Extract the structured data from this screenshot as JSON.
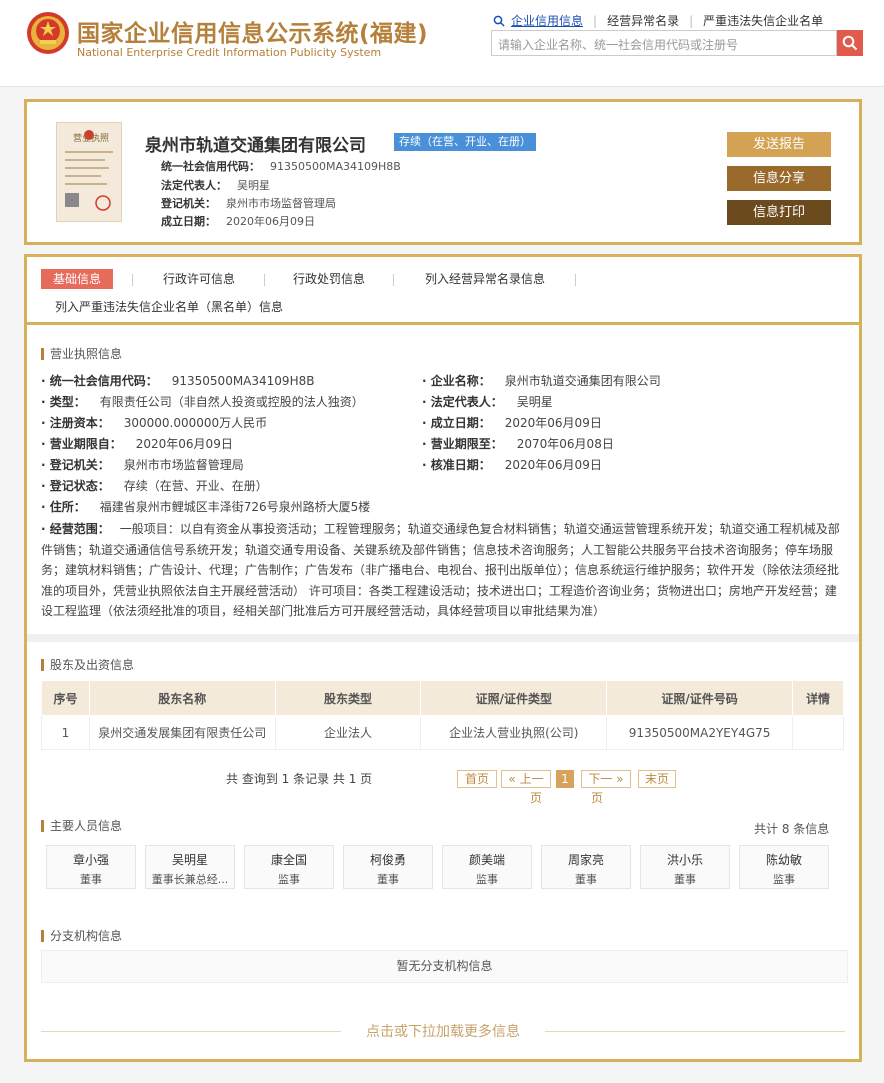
{
  "header": {
    "title": "国家企业信用信息公示系统(福建)",
    "subtitle": "National Enterprise Credit Information Publicity System",
    "links": [
      "企业信用信息",
      "经营异常名录",
      "严重违法失信企业名单"
    ],
    "search_placeholder": "请输入企业名称、统一社会信用代码或注册号"
  },
  "company": {
    "name": "泉州市轨道交通集团有限公司",
    "status": "存续（在营、开业、在册）",
    "credit_code_label": "统一社会信用代码：",
    "credit_code": "91350500MA34109H8B",
    "rep_label": "法定代表人：",
    "rep": "吴明星",
    "authority_label": "登记机关：",
    "authority": "泉州市市场监督管理局",
    "date_label": "成立日期：",
    "date": "2020年06月09日",
    "license_label": "营业执照",
    "buttons": [
      "发送报告",
      "信息分享",
      "信息打印"
    ]
  },
  "tabs": [
    "基础信息",
    "行政许可信息",
    "行政处罚信息",
    "列入经营异常名录信息",
    "列入严重违法失信企业名单（黑名单）信息"
  ],
  "license_section": {
    "title": "营业执照信息",
    "left": [
      {
        "k": "· 统一社会信用代码：",
        "v": "91350500MA34109H8B"
      },
      {
        "k": "· 类型：",
        "v": "有限责任公司（非自然人投资或控股的法人独资）"
      },
      {
        "k": "· 注册资本：",
        "v": "300000.000000万人民币"
      },
      {
        "k": "· 营业期限自：",
        "v": "2020年06月09日"
      },
      {
        "k": "· 登记机关：",
        "v": "泉州市市场监督管理局"
      },
      {
        "k": "· 登记状态：",
        "v": "存续（在营、开业、在册）"
      },
      {
        "k": "· 住所：",
        "v": "福建省泉州市鲤城区丰泽街726号泉州路桥大厦5楼"
      }
    ],
    "right": [
      {
        "k": "· 企业名称：",
        "v": "泉州市轨道交通集团有限公司"
      },
      {
        "k": "· 法定代表人：",
        "v": "吴明星"
      },
      {
        "k": "· 成立日期：",
        "v": "2020年06月09日"
      },
      {
        "k": "· 营业期限至：",
        "v": "2070年06月08日"
      },
      {
        "k": "· 核准日期：",
        "v": "2020年06月09日"
      }
    ],
    "scope_label": "· 经营范围：",
    "scope": "一般项目：以自有资金从事投资活动；工程管理服务；轨道交通绿色复合材料销售；轨道交通运营管理系统开发；轨道交通工程机械及部件销售；轨道交通通信信号系统开发；轨道交通专用设备、关键系统及部件销售；信息技术咨询服务；人工智能公共服务平台技术咨询服务；停车场服务；建筑材料销售；广告设计、代理；广告制作；广告发布（非广播电台、电视台、报刊出版单位）；信息系统运行维护服务；软件开发（除依法须经批准的项目外，凭营业执照依法自主开展经营活动） 许可项目：各类工程建设活动；技术进出口；工程造价咨询业务；货物进出口；房地产开发经营；建设工程监理（依法须经批准的项目，经相关部门批准后方可开展经营活动，具体经营项目以审批结果为准）"
  },
  "shareholders": {
    "title": "股东及出资信息",
    "headers": [
      "序号",
      "股东名称",
      "股东类型",
      "证照/证件类型",
      "证照/证件号码",
      "详情"
    ],
    "rows": [
      [
        "1",
        "泉州交通发展集团有限责任公司",
        "企业法人",
        "企业法人营业执照(公司)",
        "91350500MA2YEY4G75",
        ""
      ]
    ],
    "summary": "共 查询到 1 条记录 共 1 页",
    "pager": {
      "first": "首页",
      "prev": "« 上一",
      "prev_wrap": "页",
      "current": "1",
      "next": "下一 »",
      "next_wrap": "页",
      "last": "末页"
    }
  },
  "personnel": {
    "title": "主要人员信息",
    "total": "共计 8 条信息",
    "people": [
      {
        "name": "章小强",
        "role": "董事"
      },
      {
        "name": "吴明星",
        "role": "董事长兼总经..."
      },
      {
        "name": "康全国",
        "role": "监事"
      },
      {
        "name": "柯俊勇",
        "role": "董事"
      },
      {
        "name": "颜美端",
        "role": "监事"
      },
      {
        "name": "周家亮",
        "role": "董事"
      },
      {
        "name": "洪小乐",
        "role": "董事"
      },
      {
        "name": "陈幼敏",
        "role": "监事"
      }
    ]
  },
  "branches": {
    "title": "分支机构信息",
    "empty": "暂无分支机构信息"
  },
  "load_more": "点击或下拉加载更多信息",
  "colors": {
    "gold": "#d7b05a",
    "brand": "#b5803a",
    "active_tab": "#e66b5b",
    "status": "#4a90d9"
  }
}
